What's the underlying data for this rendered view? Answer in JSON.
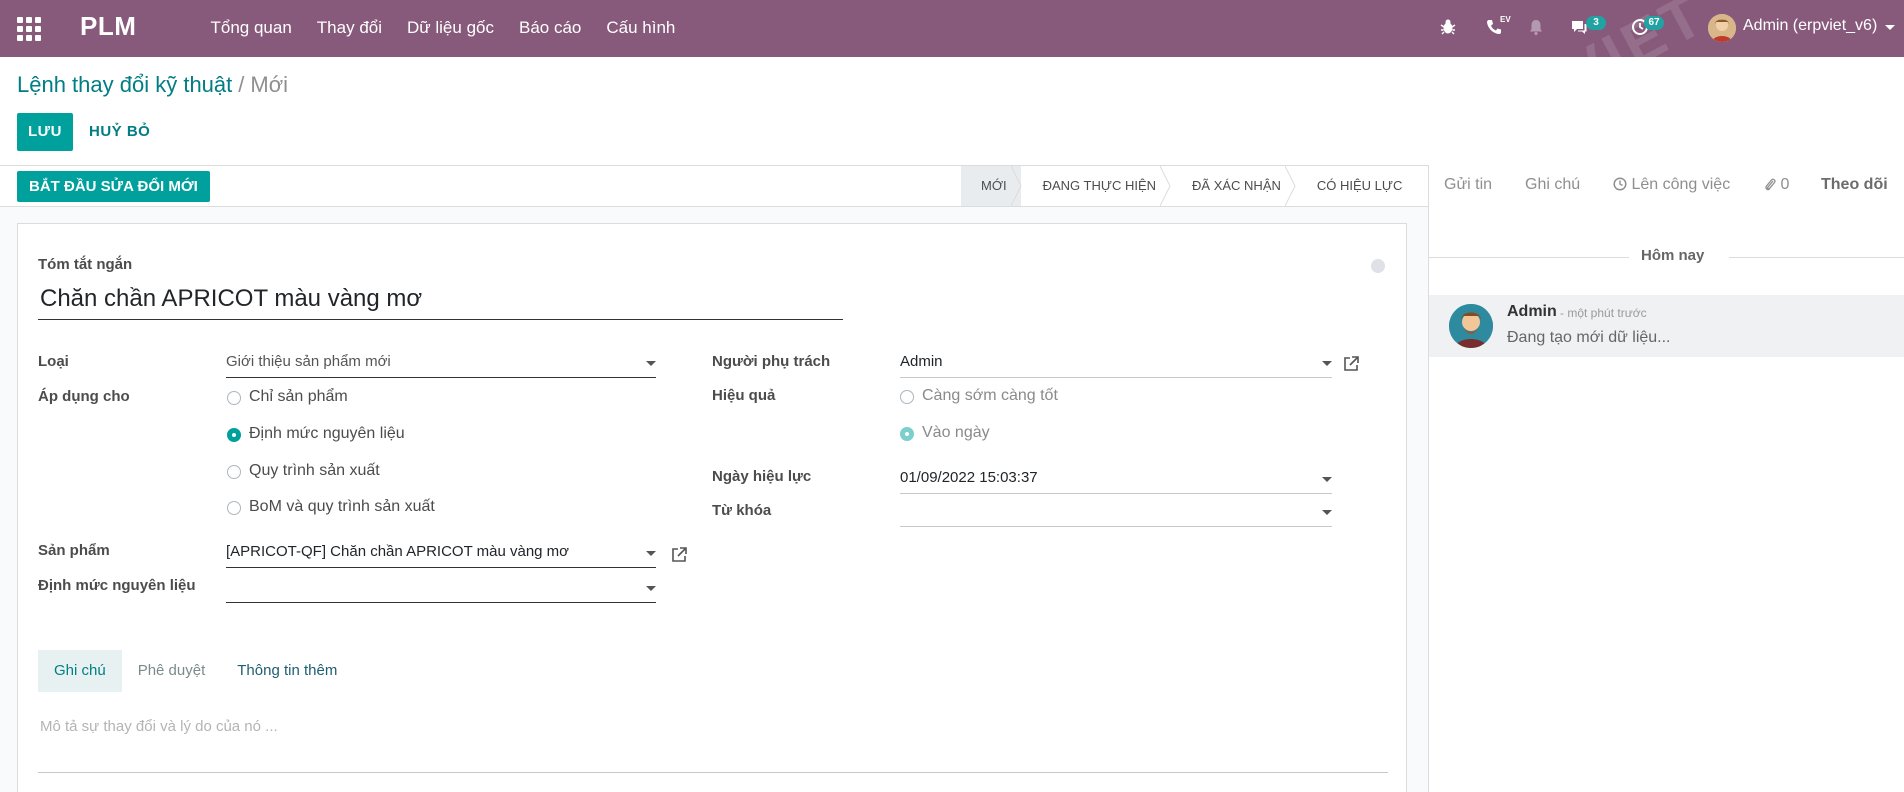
{
  "navbar": {
    "brand": "PLM",
    "menu": [
      "Tổng quan",
      "Thay đổi",
      "Dữ liệu gốc",
      "Báo cáo",
      "Cấu hình"
    ],
    "systray": {
      "messages_count": "3",
      "activities_count": "67",
      "call_label": "EV",
      "user_name": "Admin (erpviet_v6)"
    },
    "watermark": "VIET"
  },
  "breadcrumb": {
    "parent": "Lệnh thay đổi kỹ thuật",
    "separator": "/",
    "current": "Mới"
  },
  "actions": {
    "save": "LƯU",
    "discard": "HUỶ BỎ"
  },
  "statusbar": {
    "start_button": "BẮT ĐẦU SỬA ĐỔI MỚI",
    "stages": [
      "MỚI",
      "ĐANG THỰC HIỆN",
      "ĐÃ XÁC NHẬN",
      "CÓ HIỆU LỰC"
    ],
    "current_stage": "MỚI"
  },
  "form": {
    "summary_label": "Tóm tắt ngắn",
    "summary_value": "Chăn chần APRICOT màu vàng mơ",
    "type_label": "Loại",
    "type_value": "Giới thiệu sản phẩm mới",
    "apply_label": "Áp dụng cho",
    "apply_options": [
      "Chỉ sản phẩm",
      "Định mức nguyên liệu",
      "Quy trình sản xuất",
      "BoM và quy trình sản xuất"
    ],
    "apply_selected": "Định mức nguyên liệu",
    "product_label": "Sản phẩm",
    "product_value": "[APRICOT-QF] Chăn chần APRICOT màu vàng mơ",
    "bom_label": "Định mức nguyên liệu",
    "bom_value": "",
    "responsible_label": "Người phụ trách",
    "responsible_value": "Admin",
    "effectivity_label": "Hiệu quả",
    "effectivity_options": [
      "Càng sớm càng tốt",
      "Vào ngày"
    ],
    "effectivity_selected": "Vào ngày",
    "effective_date_label": "Ngày hiệu lực",
    "effective_date_value": "01/09/2022 15:03:37",
    "tags_label": "Từ khóa",
    "tags_value": "",
    "tabs": [
      "Ghi chú",
      "Phê duyệt",
      "Thông tin thêm"
    ],
    "active_tab": "Ghi chú",
    "notes_placeholder": "Mô tả sự thay đổi và lý do của nó ..."
  },
  "chatter": {
    "send_message": "Gửi tin",
    "log_note": "Ghi chú",
    "schedule_activity": "Lên công việc",
    "attachments_count": "0",
    "follow": "Theo dõi",
    "today_separator": "Hôm nay",
    "messages": [
      {
        "author": "Admin",
        "date": "- một phút trước",
        "body": "Đang tạo mới dữ liệu..."
      }
    ]
  },
  "colors": {
    "navbar": "#875a7b",
    "primary": "#00a09d",
    "link": "#017e84"
  }
}
